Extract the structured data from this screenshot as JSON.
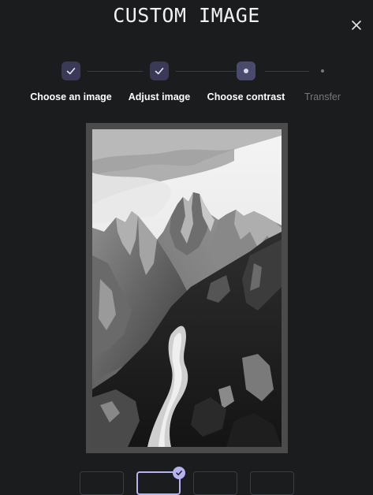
{
  "dialog": {
    "title": "CUSTOM IMAGE"
  },
  "icons": {
    "close": "close-icon",
    "check": "check-icon"
  },
  "stepper": {
    "steps": [
      {
        "label": "Choose an image",
        "status": "completed"
      },
      {
        "label": "Adjust image",
        "status": "completed"
      },
      {
        "label": "Choose contrast",
        "status": "current"
      },
      {
        "label": "Transfer",
        "status": "pending"
      }
    ]
  },
  "preview": {
    "description_icon": "image-preview",
    "mode": "grayscale"
  },
  "contrast": {
    "options_count": 4,
    "selected_index": 1
  },
  "colors": {
    "background": "#1b1c1e",
    "accent": "#b7b3f2",
    "step_node": "#3a3a58",
    "pending_text": "#77787e"
  }
}
